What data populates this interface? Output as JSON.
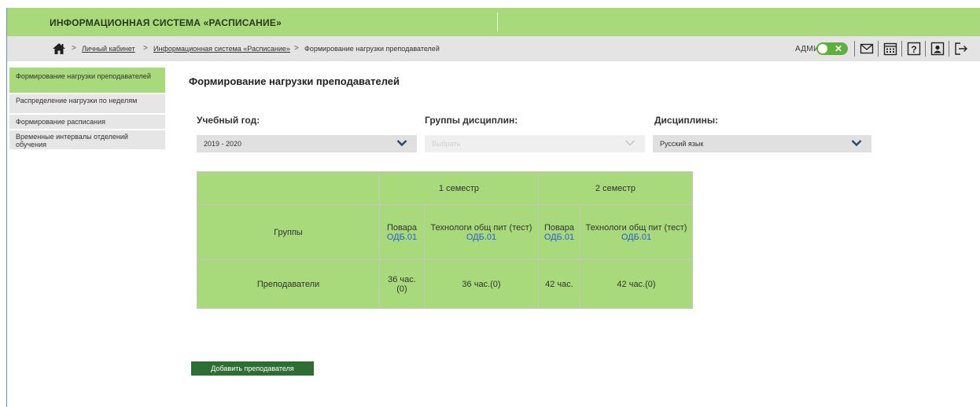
{
  "header": {
    "title": "ИНФОРМАЦИОННАЯ СИСТЕМА «РАСПИСАНИЕ»"
  },
  "breadcrumbs": {
    "items": [
      "Личный кабинет",
      "Информационная система «Расписание»",
      "Формирование нагрузки преподавателей"
    ]
  },
  "toolbar": {
    "admin_label": "АДМИН"
  },
  "icons": [
    "home-icon",
    "toggle-close-icon",
    "mail-icon",
    "calendar-icon",
    "help-icon",
    "profile-icon",
    "logout-icon",
    "chevron-down-icon"
  ],
  "sidebar": {
    "items": [
      {
        "label": "Формирование нагрузки преподавателей"
      },
      {
        "label": "Распределение нагрузки по неделям"
      },
      {
        "label": "Формирование расписания"
      },
      {
        "label": "Временные интервалы отделений обучения"
      }
    ]
  },
  "main": {
    "title": "Формирование нагрузки преподавателей",
    "filters": {
      "year": {
        "label": "Учебный год:",
        "value": "2019 - 2020"
      },
      "groups": {
        "label": "Группы дисциплин:",
        "placeholder": "Выбрать"
      },
      "discipline": {
        "label": "Дисциплины:",
        "value": "Русский язык"
      }
    },
    "table": {
      "semesters": [
        "1 семестр",
        "2 семестр"
      ],
      "row_groups_label": "Группы",
      "row_teachers_label": "Преподаватели",
      "columns": [
        {
          "group": "Повара",
          "code": "ОДБ.01",
          "hours": "36 час.(0)"
        },
        {
          "group": "Технологи общ пит (тест)",
          "code": "ОДБ.01",
          "hours": "36 час.(0)"
        },
        {
          "group": "Повара",
          "code": "ОДБ.01",
          "hours": "42 час."
        },
        {
          "group": "Технологи общ пит (тест)",
          "code": "ОДБ.01",
          "hours": "42 час.(0)"
        }
      ]
    },
    "add_button": "Добавить преподавателя"
  },
  "colors": {
    "accent": "#a8d97a",
    "button": "#2d6e33",
    "link": "#2a5bd7"
  }
}
